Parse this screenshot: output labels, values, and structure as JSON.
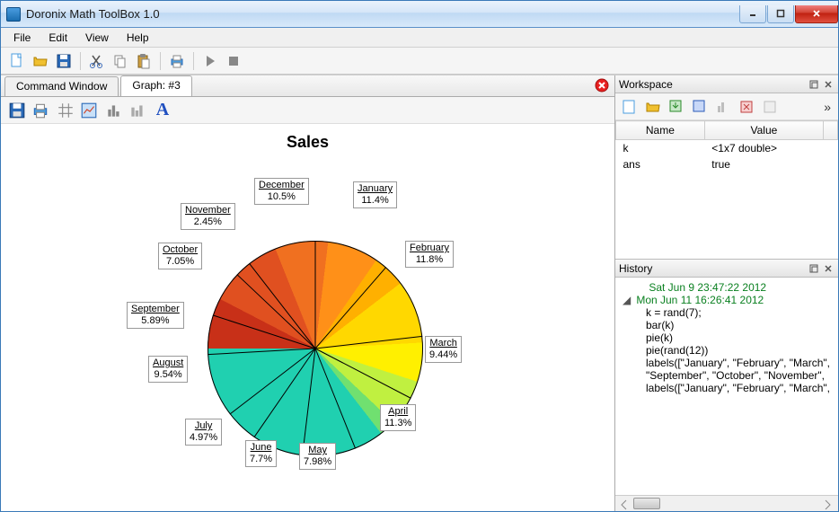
{
  "window": {
    "title": "Doronix Math ToolBox 1.0"
  },
  "menubar": [
    "File",
    "Edit",
    "View",
    "Help"
  ],
  "tabs": [
    {
      "label": "Command Window",
      "active": false
    },
    {
      "label": "Graph: #3",
      "active": true
    }
  ],
  "chart_data": {
    "type": "pie",
    "title": "Sales",
    "categories": [
      "January",
      "February",
      "March",
      "April",
      "May",
      "June",
      "July",
      "August",
      "September",
      "October",
      "November",
      "December"
    ],
    "values": [
      11.4,
      11.8,
      9.44,
      11.3,
      7.98,
      7.7,
      4.97,
      9.54,
      5.89,
      7.05,
      2.45,
      10.5
    ],
    "labels": [
      "11.4%",
      "11.8%",
      "9.44%",
      "11.3%",
      "7.98%",
      "7.7%",
      "4.97%",
      "9.54%",
      "5.89%",
      "7.05%",
      "2.45%",
      "10.5%"
    ],
    "colors": [
      "#a00000",
      "#b51010",
      "#c83018",
      "#e05020",
      "#f07020",
      "#ff9018",
      "#ffb000",
      "#ffd800",
      "#fff000",
      "#c0f040",
      "#70e070",
      "#20d0b0"
    ]
  },
  "workspace": {
    "title": "Workspace",
    "columns": [
      "Name",
      "Value"
    ],
    "rows": [
      {
        "name": "k",
        "value": "<1x7 double>"
      },
      {
        "name": "ans",
        "value": "true"
      }
    ]
  },
  "history": {
    "title": "History",
    "entries": [
      {
        "type": "date",
        "text": "Sat Jun 9 23:47:22 2012",
        "expanded": false
      },
      {
        "type": "date",
        "text": "Mon Jun 11 16:26:41 2012",
        "expanded": true
      },
      {
        "type": "cmd",
        "text": "k = rand(7);"
      },
      {
        "type": "cmd",
        "text": "bar(k)"
      },
      {
        "type": "cmd",
        "text": "pie(k)"
      },
      {
        "type": "cmd",
        "text": "pie(rand(12))"
      },
      {
        "type": "cmd",
        "text": "labels([\"January\", \"February\", \"March\","
      },
      {
        "type": "cmd",
        "text": "\"September\", \"October\", \"November\","
      },
      {
        "type": "cmd",
        "text": "labels([\"January\", \"February\", \"March\","
      }
    ]
  }
}
